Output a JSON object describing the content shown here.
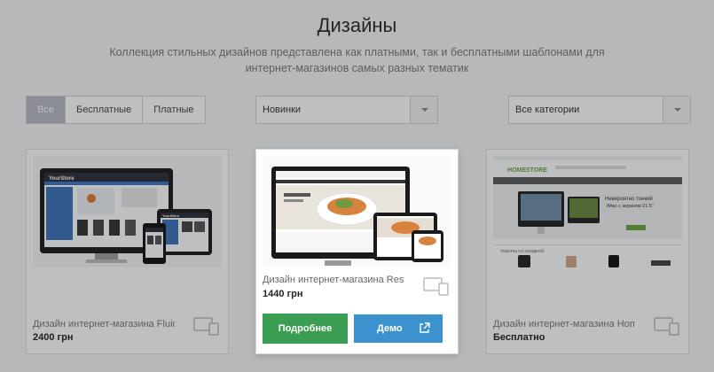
{
  "header": {
    "title": "Дизайны",
    "subtitle": "Коллекция стильных дизайнов представлена как платными, так и бесплатными шаблонами для интернет-магазинов самых разных тематик"
  },
  "filters": {
    "price_tabs": [
      "Все",
      "Бесплатные",
      "Платные"
    ],
    "active_tab": "Все",
    "sort_select": "Новинки",
    "category_select": "Все категории"
  },
  "cards": [
    {
      "name": "Дизайн интернет-магазина Fluid ...",
      "price": "2400 грн",
      "thumb_logo": "YourStore"
    },
    {
      "name": "Дизайн интернет-магазина Resta...",
      "price": "1440 грн",
      "thumb_logo": "",
      "more_label": "Подробнее",
      "demo_label": "Демо"
    },
    {
      "name": "Дизайн интернет-магазина Home ...",
      "price": "Бесплатно",
      "thumb_logo": "HOMESTORE",
      "thumb_slogan": "Невероятно тонкий iMac с экраном 21.5\"",
      "thumb_section": "ТОВАРЫ СО СКИДКОЙ"
    }
  ],
  "colors": {
    "green_button": "#3a9d51",
    "blue_button": "#3b92cf",
    "active_tab_bg": "#b7bcc2"
  }
}
